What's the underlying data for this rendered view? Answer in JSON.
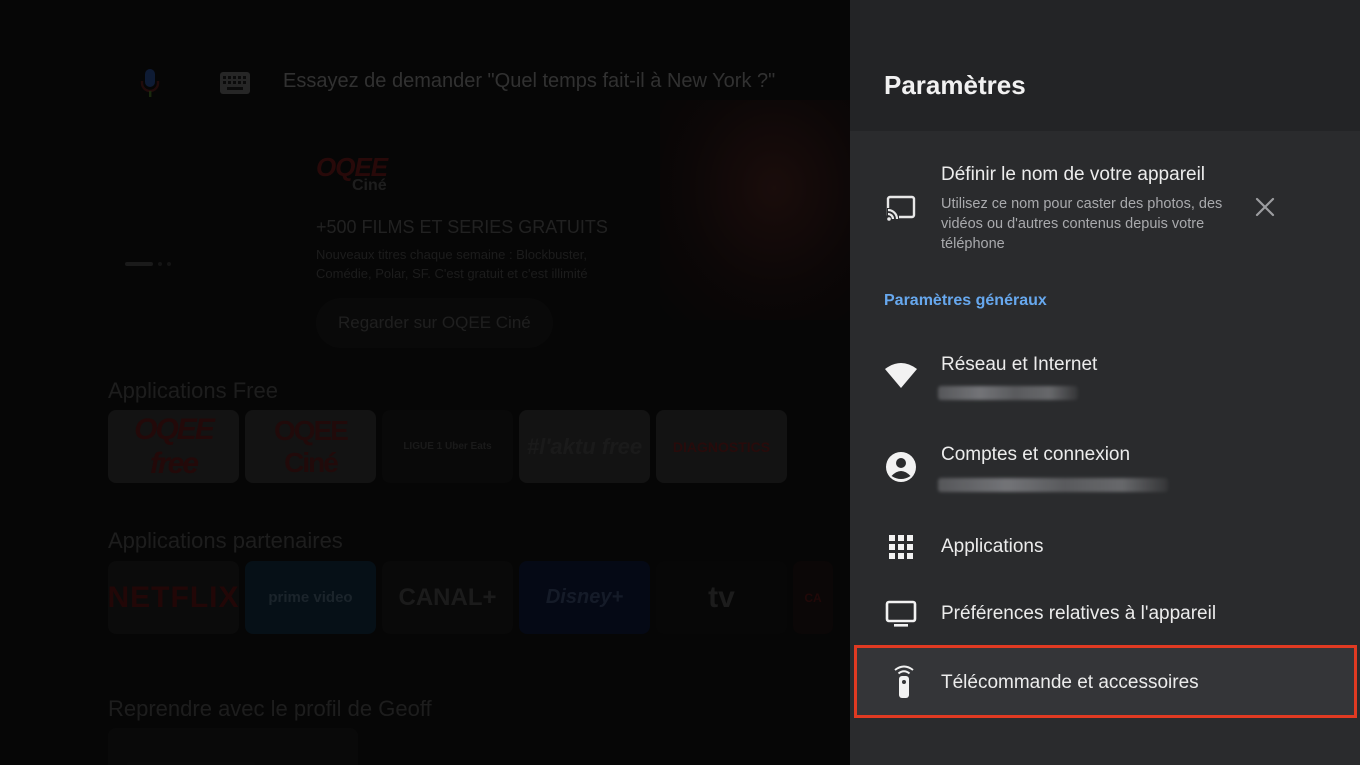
{
  "background": {
    "search_hint": "Essayez de demander \"Quel temps fait-il à New York ?\"",
    "hero": {
      "logo_main": "OQEE",
      "logo_sub": "Ciné",
      "title": "+500 FILMS ET SERIES GRATUITS",
      "description": "Nouveaux titres chaque semaine : Blockbuster, Comédie, Polar, SF. C'est gratuit et c'est illimité",
      "button_label": "Regarder sur OQEE Ciné"
    },
    "rows": [
      {
        "title": "Applications Free",
        "tiles": [
          "OQEE free",
          "OQEE Ciné",
          "LIGUE 1 Uber Eats",
          "#l'aktu free",
          "DIAGNOSTICS"
        ]
      },
      {
        "title": "Applications partenaires",
        "tiles": [
          "NETFLIX",
          "prime video",
          "CANAL+",
          "Disney+",
          "tv",
          "CA"
        ]
      },
      {
        "title": "Reprendre avec le profil de Geoff"
      }
    ]
  },
  "settings": {
    "title": "Paramètres",
    "device_name": {
      "title": "Définir le nom de votre appareil",
      "subtitle": "Utilisez ce nom pour caster des photos, des vidéos ou d'autres contenus depuis votre téléphone",
      "icon": "cast-icon"
    },
    "section_title": "Paramètres généraux",
    "items": [
      {
        "label": "Réseau et Internet",
        "icon": "wifi-icon"
      },
      {
        "label": "Comptes et connexion",
        "icon": "account-icon"
      },
      {
        "label": "Applications",
        "icon": "apps-grid-icon"
      },
      {
        "label": "Préférences relatives à l'appareil",
        "icon": "tv-icon"
      },
      {
        "label": "Télécommande et accessoires",
        "icon": "remote-icon"
      }
    ],
    "colors": {
      "panel_bg": "#2a2b2d",
      "header_bg": "#232426",
      "accent": "#67a8ee",
      "highlight_border": "#e03a22"
    }
  }
}
